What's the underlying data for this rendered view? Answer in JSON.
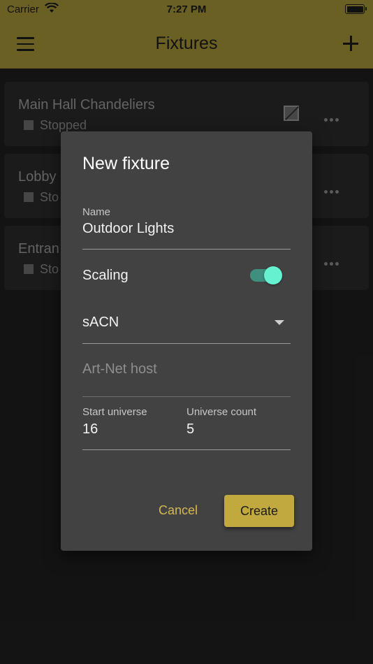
{
  "status_bar": {
    "carrier": "Carrier",
    "time": "7:27 PM"
  },
  "app_bar": {
    "title": "Fixtures"
  },
  "fixtures": [
    {
      "name": "Main Hall Chandeliers",
      "status": "Stopped"
    },
    {
      "name": "Lobby",
      "status": "Sto"
    },
    {
      "name": "Entran",
      "status": "Sto"
    }
  ],
  "dialog": {
    "title": "New fixture",
    "name_label": "Name",
    "name_value": "Outdoor Lights",
    "scaling_label": "Scaling",
    "scaling_on": true,
    "protocol_value": "sACN",
    "host_placeholder": "Art-Net host",
    "start_universe_label": "Start universe",
    "start_universe_value": "16",
    "universe_count_label": "Universe count",
    "universe_count_value": "5",
    "cancel_label": "Cancel",
    "create_label": "Create"
  },
  "colors": {
    "app_bar": "#6b6024",
    "accent": "#c2a93f",
    "toggle_thumb": "#64f2d0"
  },
  "icons": [
    "wifi-icon",
    "battery-icon",
    "menu-icon",
    "plus-icon",
    "edit-icon",
    "more-icon",
    "checkbox-icon",
    "dropdown-caret-icon"
  ]
}
